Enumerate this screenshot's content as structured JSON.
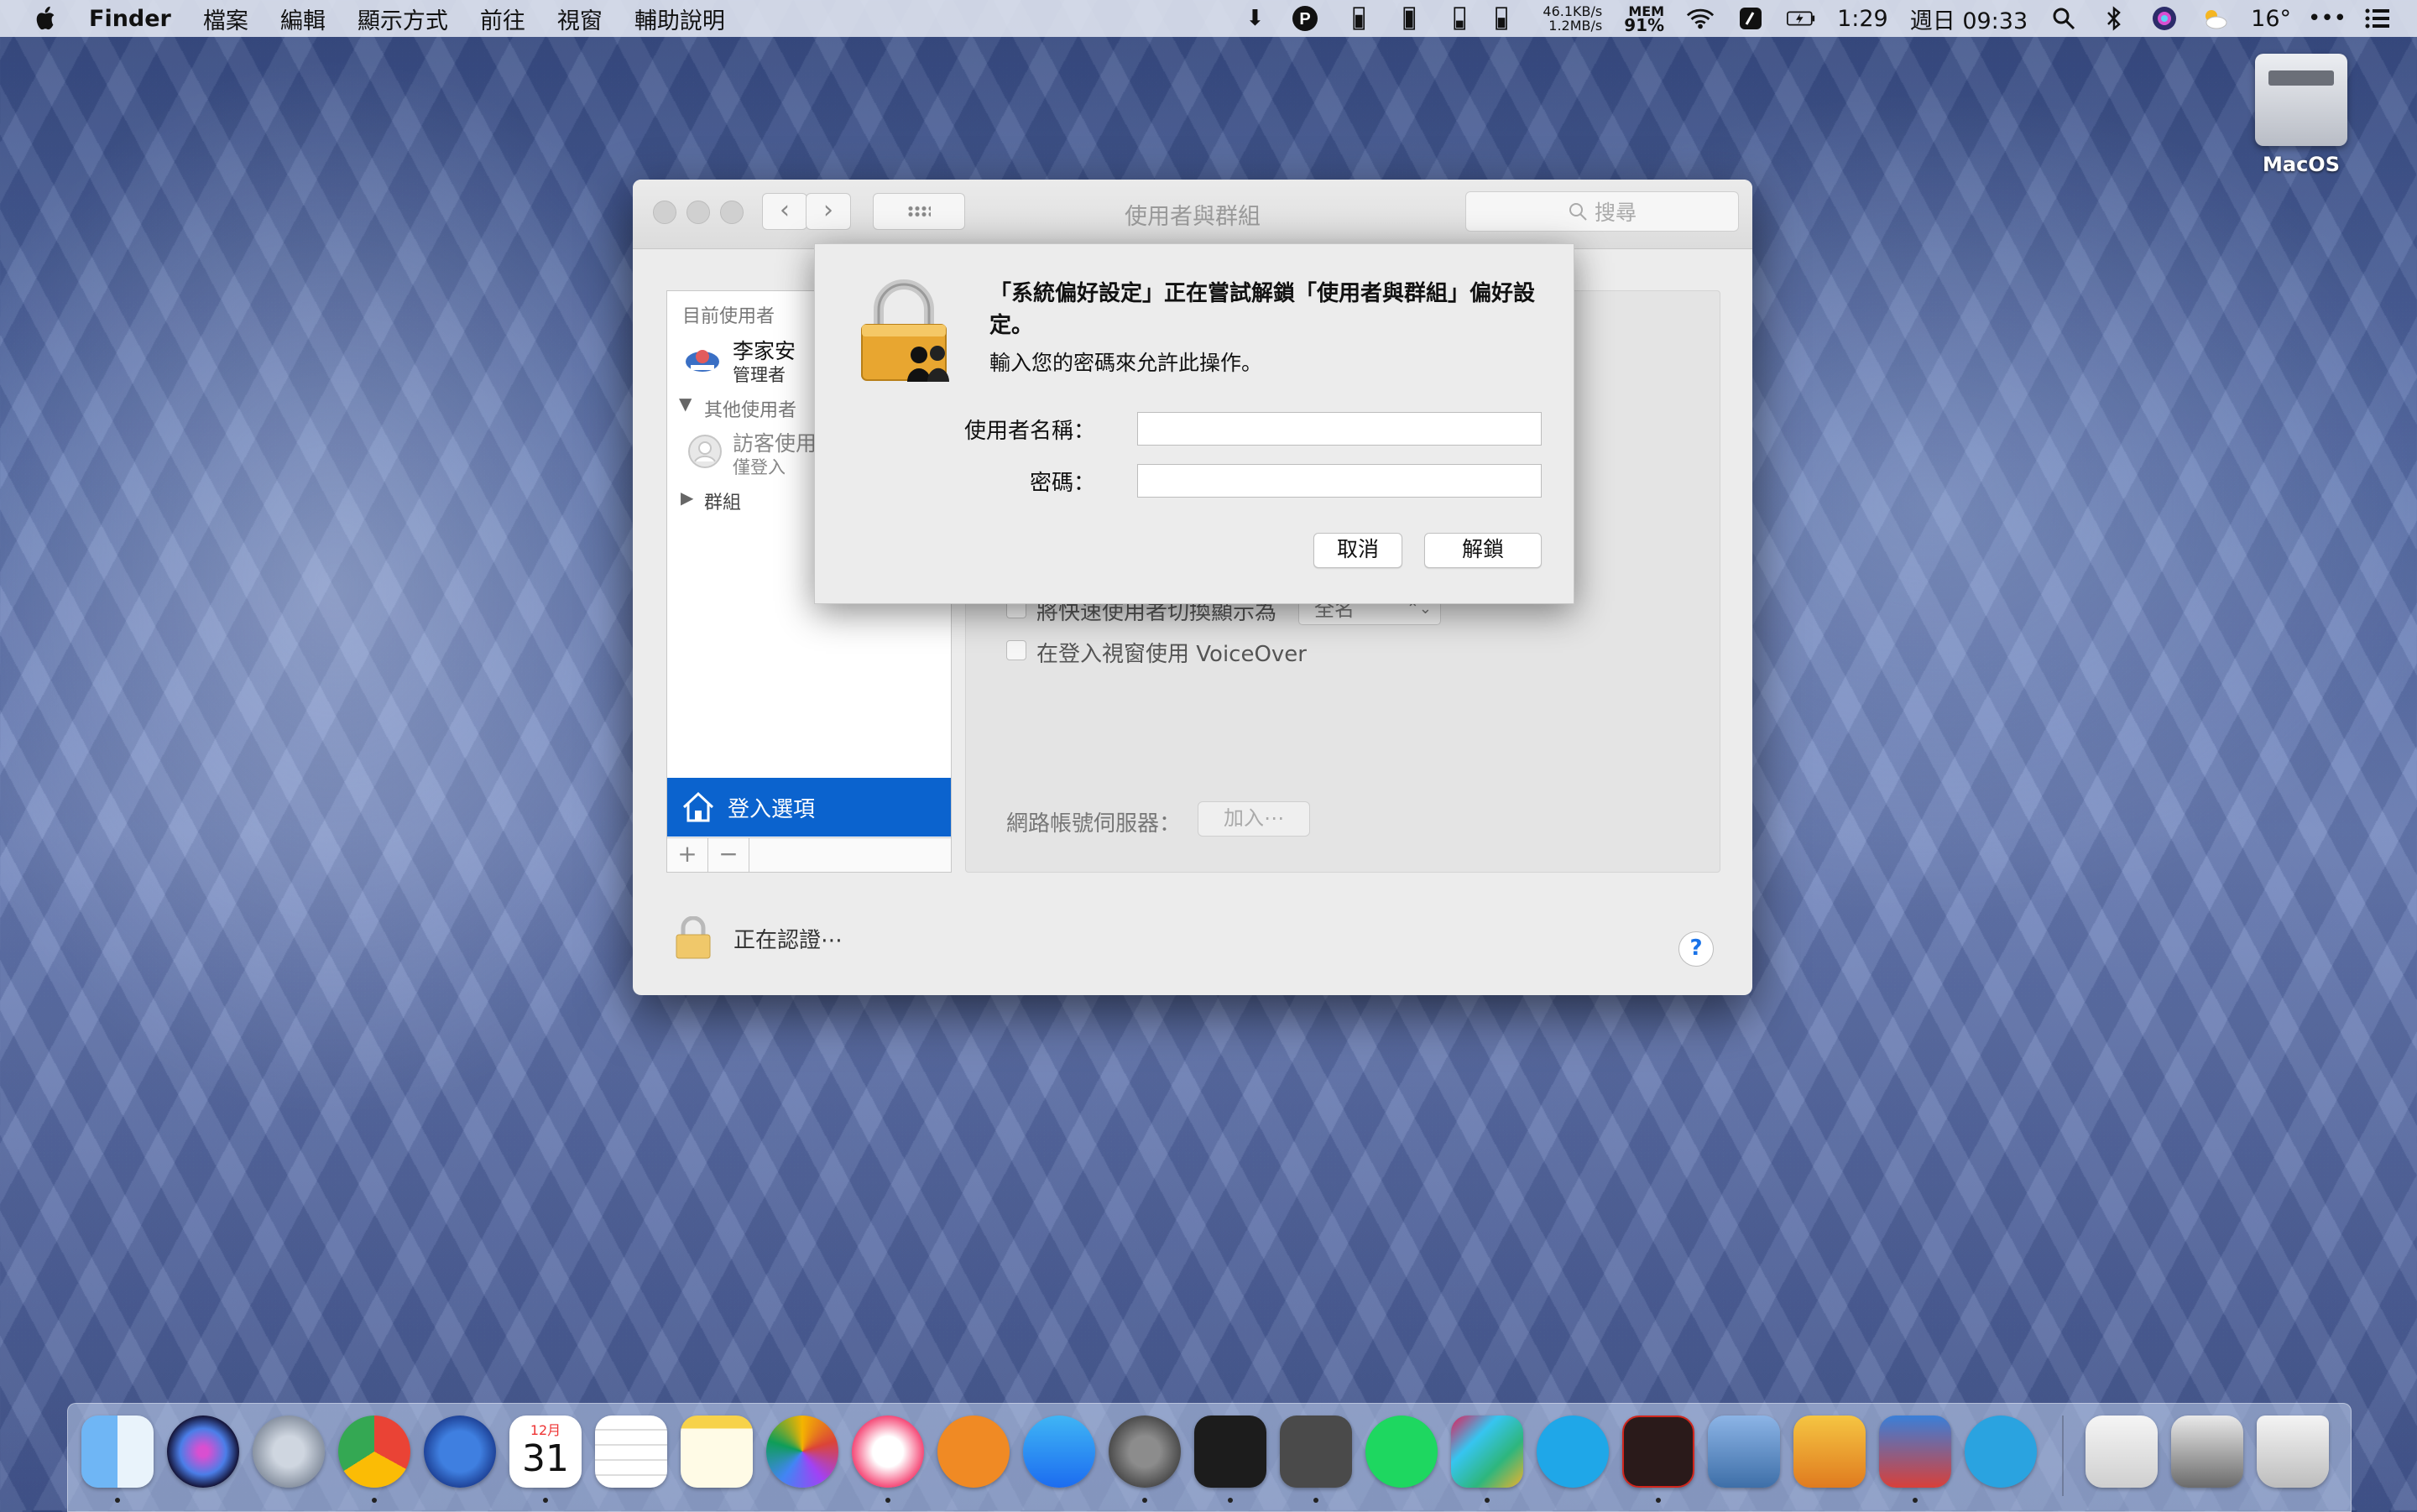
{
  "menubar": {
    "app_name": "Finder",
    "items": [
      "檔案",
      "編輯",
      "顯示方式",
      "前往",
      "視窗",
      "輔助說明"
    ],
    "net_up": "46.1KB/s",
    "net_down": "1.2MB/s",
    "mem_label": "MEM",
    "mem_value": "91%",
    "battery_time": "1:29",
    "clock": "週日 09:33",
    "weather_temp": "16°"
  },
  "desktop": {
    "drive_label": "MacOS"
  },
  "window": {
    "title": "使用者與群組",
    "search_placeholder": "搜尋",
    "sidebar": {
      "current_users_header": "目前使用者",
      "current_user_name": "李家安",
      "current_user_role": "管理者",
      "other_users_header": "其他使用者",
      "guest_name": "訪客使用",
      "guest_sub": "僅登入",
      "groups_label": "群組",
      "selected_item": "登入選項",
      "add_label": "+",
      "remove_label": "−"
    },
    "main": {
      "fast_switch_label": "將快速使用者切換顯示為",
      "fast_switch_value": "全名",
      "voiceover_label": "在登入視窗使用 VoiceOver",
      "network_server_label": "網路帳號伺服器：",
      "join_button": "加入⋯"
    },
    "lock_status": "正在認證⋯",
    "help_label": "?"
  },
  "auth_sheet": {
    "message": "「系統偏好設定」正在嘗試解鎖「使用者與群組」偏好設定。",
    "instruction": "輸入您的密碼來允許此操作。",
    "username_label": "使用者名稱：",
    "username_value": "",
    "password_label": "密碼：",
    "password_value": "",
    "cancel_button": "取消",
    "unlock_button": "解鎖"
  },
  "dock": {
    "calendar_month": "12月",
    "calendar_day": "31"
  },
  "colors": {
    "selection_blue": "#0b63ce",
    "lock_gold": "#e8a630"
  }
}
